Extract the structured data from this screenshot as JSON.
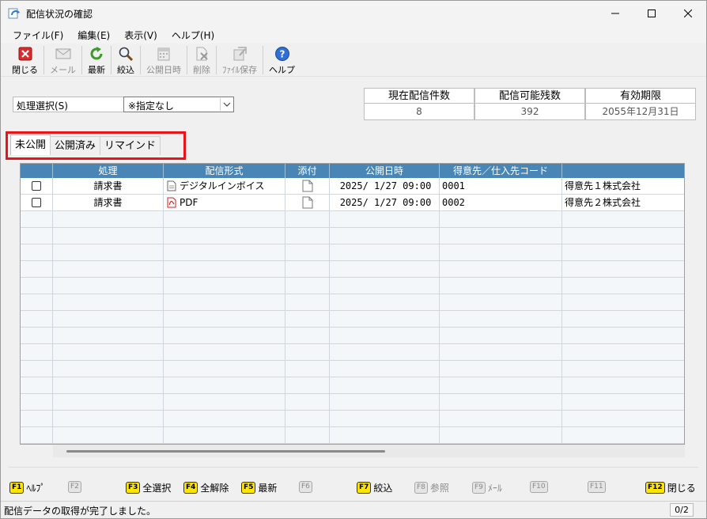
{
  "window": {
    "title": "配信状況の確認"
  },
  "menu": [
    "ファイル(F)",
    "編集(E)",
    "表示(V)",
    "ヘルプ(H)"
  ],
  "toolbar": [
    {
      "label": "閉じる",
      "icon": "close-red-icon",
      "enabled": true
    },
    {
      "label": "メール",
      "icon": "mail-icon",
      "enabled": false
    },
    {
      "label": "最新",
      "icon": "refresh-icon",
      "enabled": true
    },
    {
      "label": "絞込",
      "icon": "magnifier-icon",
      "enabled": true
    },
    {
      "label": "公開日時",
      "icon": "calendar-icon",
      "enabled": false
    },
    {
      "label": "削除",
      "icon": "delete-doc-icon",
      "enabled": false
    },
    {
      "label": "ﾌｧｲﾙ保存",
      "icon": "file-save-icon",
      "enabled": false
    },
    {
      "label": "ヘルプ",
      "icon": "help-icon",
      "enabled": true
    }
  ],
  "selection": {
    "label": "処理選択(S)",
    "value": "※指定なし"
  },
  "stats": [
    {
      "header": "現在配信件数",
      "value": "8"
    },
    {
      "header": "配信可能残数",
      "value": "392"
    },
    {
      "header": "有効期限",
      "value": "2055年12月31日"
    }
  ],
  "tabs": [
    "未公開",
    "公開済み",
    "リマインド"
  ],
  "grid": {
    "headers": [
      "",
      "処理",
      "配信形式",
      "添付",
      "公開日時",
      "得意先／仕入先コード",
      ""
    ],
    "rows": [
      {
        "process": "請求書",
        "format": "デジタルインボイス",
        "format_icon": "document-icon",
        "date": "2025/ 1/27 09:00",
        "code": "0001",
        "name": "得意先１株式会社"
      },
      {
        "process": "請求書",
        "format": "PDF",
        "format_icon": "pdf-icon",
        "date": "2025/ 1/27 09:00",
        "code": "0002",
        "name": "得意先２株式会社"
      }
    ]
  },
  "fkeys": [
    {
      "key": "F1",
      "label": "ﾍﾙﾌﾟ",
      "enabled": true
    },
    {
      "key": "F2",
      "label": "",
      "enabled": false
    },
    {
      "key": "F3",
      "label": "全選択",
      "enabled": true
    },
    {
      "key": "F4",
      "label": "全解除",
      "enabled": true
    },
    {
      "key": "F5",
      "label": "最新",
      "enabled": true
    },
    {
      "key": "F6",
      "label": "",
      "enabled": false
    },
    {
      "key": "F7",
      "label": "絞込",
      "enabled": true
    },
    {
      "key": "F8",
      "label": "参照",
      "enabled": false
    },
    {
      "key": "F9",
      "label": "ﾒｰﾙ",
      "enabled": false
    },
    {
      "key": "F10",
      "label": "",
      "enabled": false
    },
    {
      "key": "F11",
      "label": "",
      "enabled": false
    },
    {
      "key": "F12",
      "label": "閉じる",
      "enabled": true
    }
  ],
  "status": {
    "message": "配信データの取得が完了しました。",
    "page": "0/2"
  }
}
